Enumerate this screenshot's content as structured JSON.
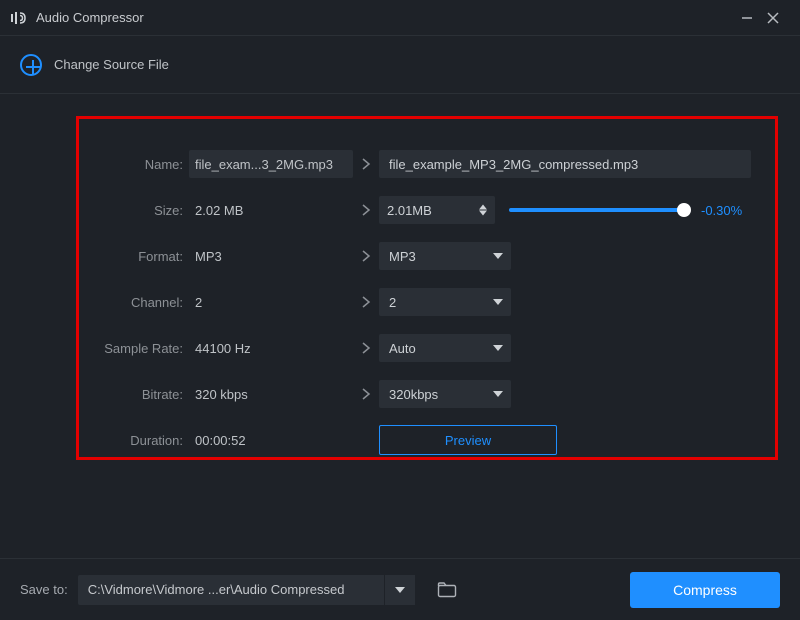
{
  "app": {
    "title": "Audio Compressor"
  },
  "actions": {
    "change_source": "Change Source File",
    "preview": "Preview",
    "compress": "Compress"
  },
  "labels": {
    "name": "Name:",
    "size": "Size:",
    "format": "Format:",
    "channel": "Channel:",
    "sample_rate": "Sample Rate:",
    "bitrate": "Bitrate:",
    "duration": "Duration:",
    "save_to": "Save to:"
  },
  "source": {
    "name": "file_exam...3_2MG.mp3",
    "size": "2.02 MB",
    "format": "MP3",
    "channel": "2",
    "sample_rate": "44100 Hz",
    "bitrate": "320 kbps",
    "duration": "00:00:52"
  },
  "target": {
    "name": "file_example_MP3_2MG_compressed.mp3",
    "size": "2.01MB",
    "size_delta": "-0.30%",
    "format": "MP3",
    "channel": "2",
    "sample_rate": "Auto",
    "bitrate": "320kbps"
  },
  "save": {
    "path": "C:\\Vidmore\\Vidmore ...er\\Audio Compressed"
  }
}
